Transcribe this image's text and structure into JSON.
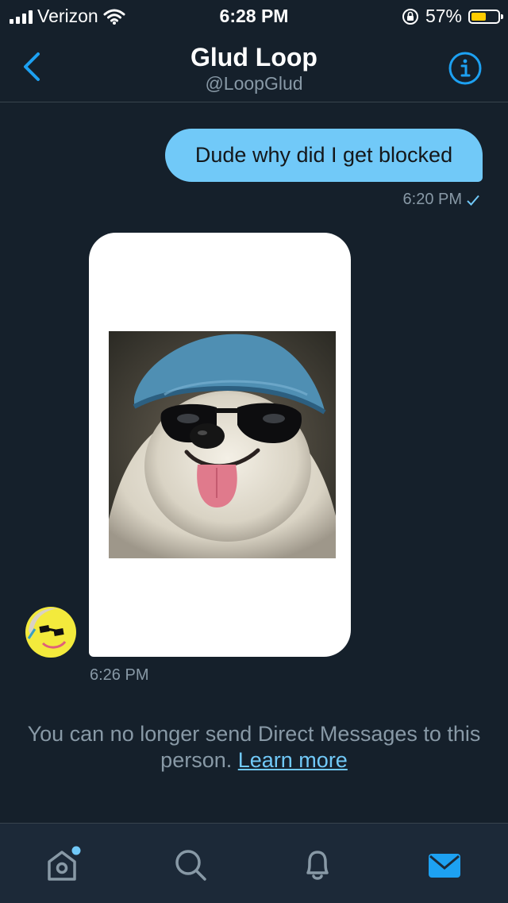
{
  "status_bar": {
    "carrier": "Verizon",
    "time": "6:28 PM",
    "battery_percent": "57%",
    "battery_level": 0.57,
    "icons": [
      "signal-icon",
      "wifi-icon",
      "rotation-lock-icon",
      "battery-icon"
    ]
  },
  "header": {
    "title": "Glud Loop",
    "handle": "@LoopGlud",
    "icons": [
      "back-chevron-icon",
      "info-icon"
    ]
  },
  "messages": [
    {
      "direction": "outgoing",
      "text": "Dude why did I get blocked",
      "time": "6:20 PM",
      "status_icon": "checkmark-icon"
    },
    {
      "direction": "incoming",
      "media": "dog-with-sunglasses-image",
      "time": "6:26 PM"
    }
  ],
  "notice": {
    "text": "You can no longer send Direct Messages to this person.",
    "link": "Learn more"
  },
  "tab_bar": {
    "items": [
      "home-icon",
      "search-icon",
      "notifications-icon",
      "messages-icon"
    ],
    "active": "messages-icon"
  },
  "colors": {
    "background": "#15202b",
    "accent": "#71c9f8",
    "muted_text": "#8899a6",
    "battery": "#ffcc00"
  }
}
